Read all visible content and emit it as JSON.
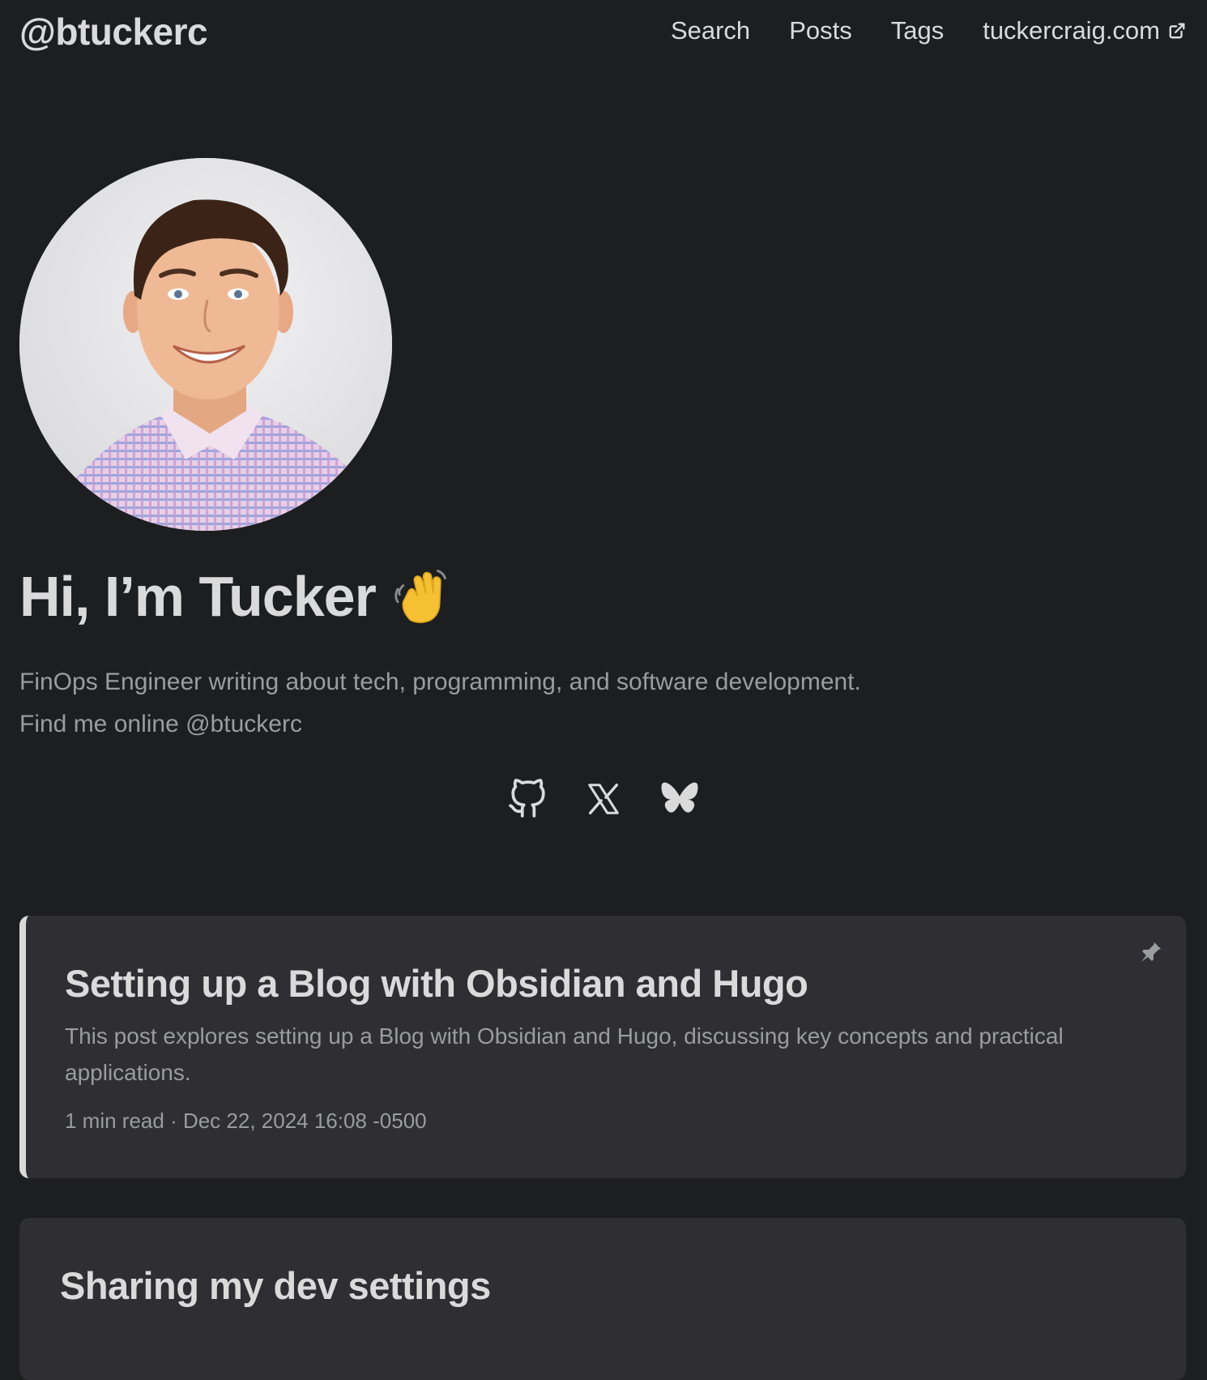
{
  "header": {
    "logo": "@btuckerc",
    "menu": [
      {
        "label": "Search"
      },
      {
        "label": "Posts"
      },
      {
        "label": "Tags"
      },
      {
        "label": "tuckercraig.com",
        "icon": "external-link-icon"
      }
    ]
  },
  "profile": {
    "avatar_alt": "profile-photo",
    "title": "Hi, I’m Tucker",
    "title_icon": "waving-hand-icon",
    "description_line1": "FinOps Engineer writing about tech, programming, and software development.",
    "description_line2": "Find me online @btuckerc",
    "social": [
      "github-icon",
      "x-icon",
      "bluesky-icon"
    ]
  },
  "posts": [
    {
      "title": "Setting up a Blog with Obsidian and Hugo",
      "summary": "This post explores setting up a Blog with Obsidian and Hugo, discussing key concepts and practical applications.",
      "meta": "1 min read · Dec 22, 2024 16:08 -0500",
      "pinned": true
    },
    {
      "title": "Sharing my dev settings"
    }
  ],
  "colors": {
    "background": "#1d1e20",
    "card": "#2e2e33",
    "text": "#dadadb",
    "secondary": "#9b9c9d"
  }
}
